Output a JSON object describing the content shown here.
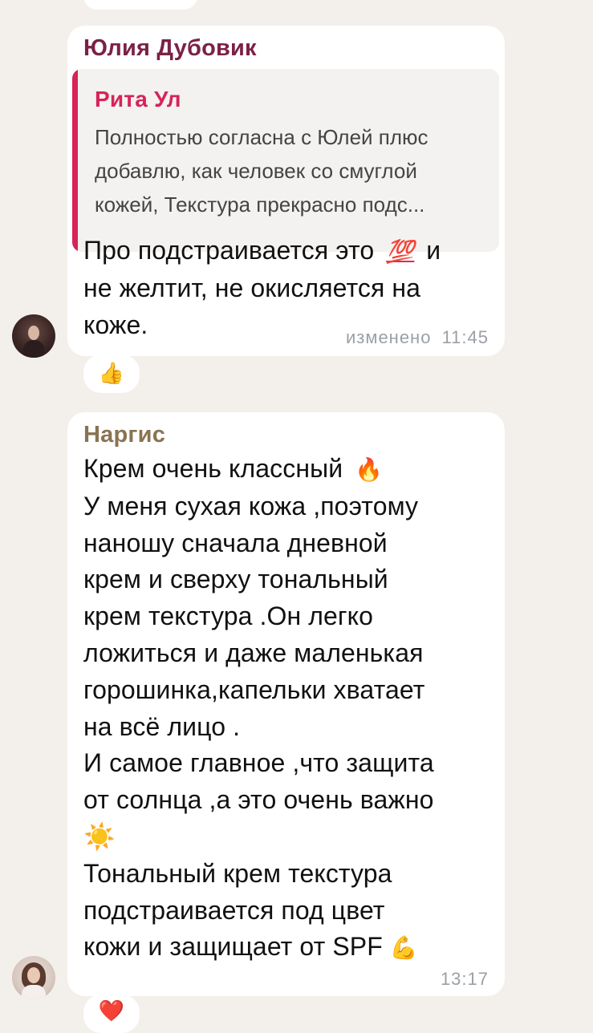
{
  "messages": [
    {
      "sender": "Юлия Дубовик",
      "sender_color": "#7b2146",
      "reply": {
        "author": "Рита Ул",
        "author_color": "#d62459",
        "lines": [
          "Полностью согласна с Юлей плюс",
          "добавлю, как человек со смуглой",
          "кожей, Текстура прекрасно подс..."
        ]
      },
      "text_lines": [
        "Про подстраивается это",
        "не желтит, не окисляется на",
        "коже."
      ],
      "inline_word_after_emoji": "и",
      "emoji_hundred": "💯",
      "edited_label": "изменено",
      "time": "11:45",
      "reaction": "👍"
    },
    {
      "sender": "Наргис",
      "sender_color": "#8a7350",
      "text_lines": [
        "Крем очень классный",
        "У меня сухая кожа ,поэтому",
        "наношу сначала  дневной",
        "крем и сверху тональный",
        "крем текстура .Он легко",
        "ложиться и даже маленькая",
        "горошинка,капельки хватает",
        "на всё лицо .",
        "И самое главное ,что защита",
        "от солнца ,а это очень важно",
        "",
        "Тональный крем текстура",
        "подстраивается под цвет",
        "кожи и защищает от SPF"
      ],
      "emoji_fire": "🔥",
      "emoji_sun": "☀️",
      "emoji_muscle": "💪",
      "time": "13:17",
      "reaction": "❤️"
    }
  ]
}
